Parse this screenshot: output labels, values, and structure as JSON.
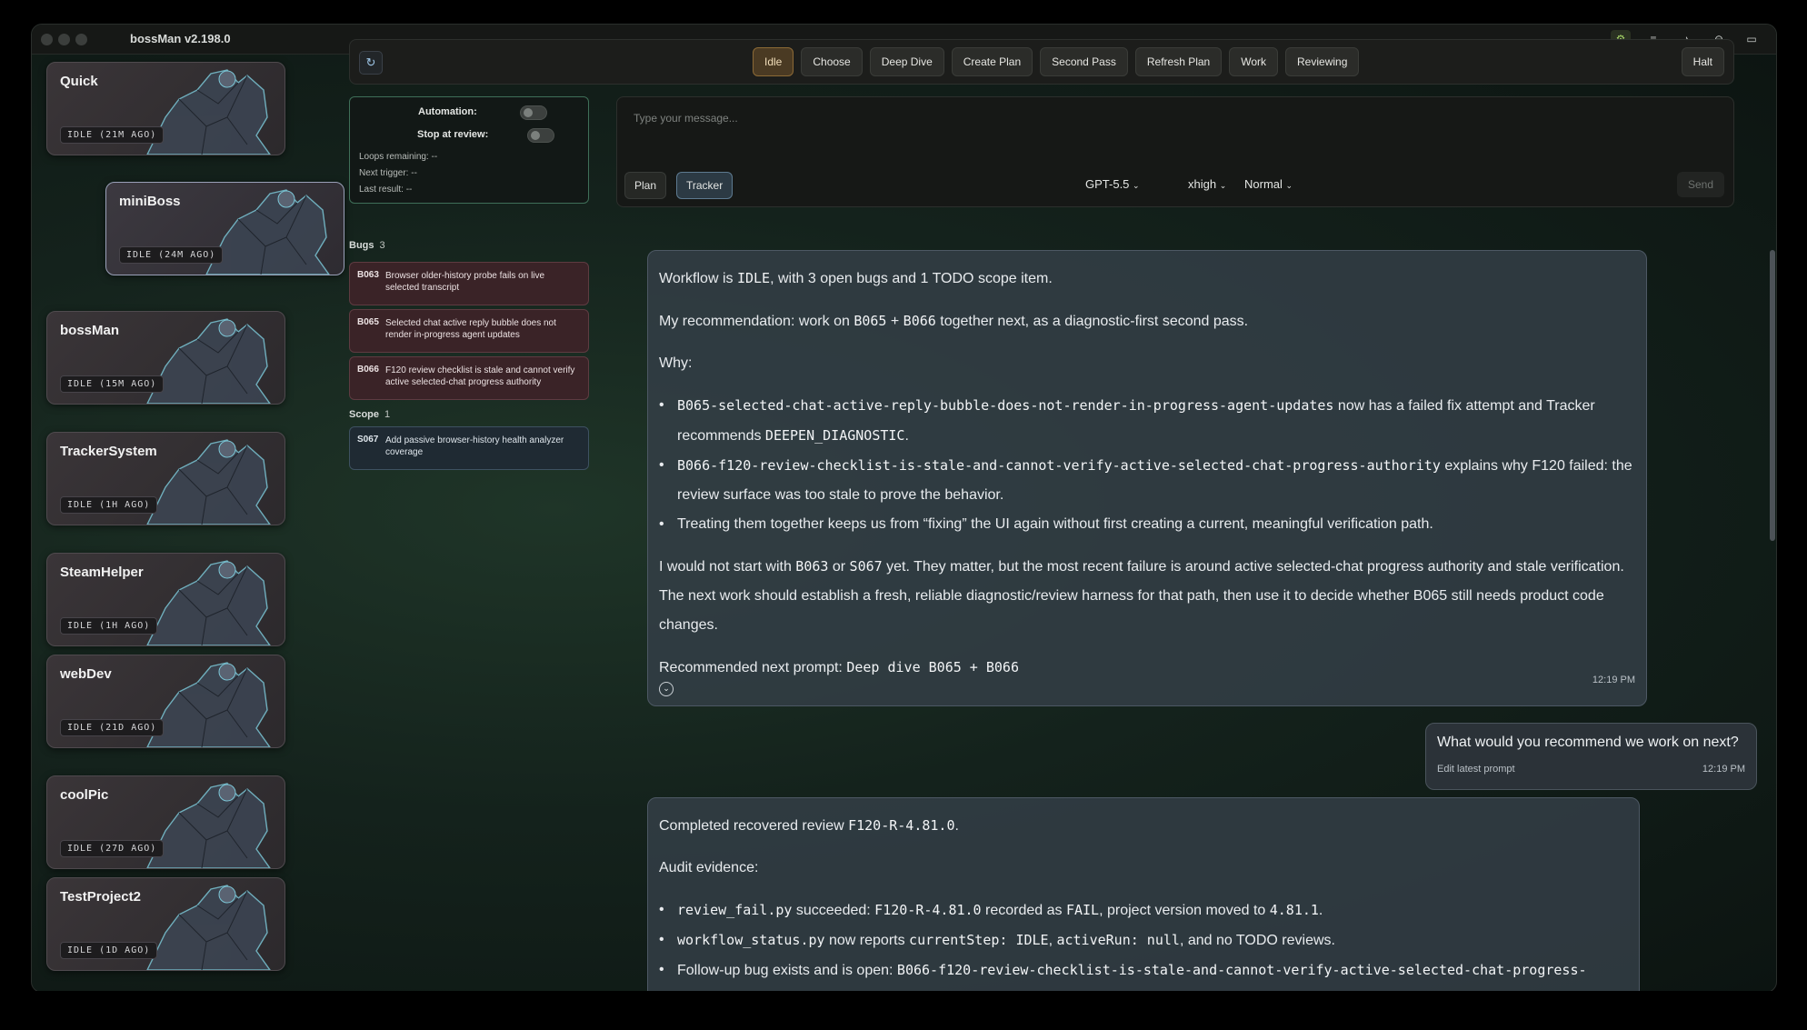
{
  "app": {
    "title": "bossMan v2.198.0"
  },
  "sidebar": {
    "projects": [
      {
        "name": "Quick",
        "status": "IDLE (21M AGO)"
      },
      {
        "name": "miniBoss",
        "status": "IDLE (24M AGO)"
      },
      {
        "name": "bossMan",
        "status": "IDLE (15M AGO)"
      },
      {
        "name": "TrackerSystem",
        "status": "IDLE (1H AGO)"
      },
      {
        "name": "SteamHelper",
        "status": "IDLE (1H AGO)"
      },
      {
        "name": "webDev",
        "status": "IDLE (21D AGO)"
      },
      {
        "name": "coolPic",
        "status": "IDLE (27D AGO)"
      },
      {
        "name": "TestProject2",
        "status": "IDLE (1D AGO)"
      }
    ]
  },
  "toolbar": {
    "refresh_icon": "↻",
    "workflow": [
      "Idle",
      "Choose",
      "Deep Dive",
      "Create Plan",
      "Second Pass",
      "Refresh Plan",
      "Work",
      "Reviewing"
    ],
    "halt": "Halt"
  },
  "automation": {
    "automation_label": "Automation:",
    "stop_label": "Stop at review:",
    "loops": "Loops remaining: --",
    "next_trigger": "Next trigger: --",
    "last_result": "Last result: --"
  },
  "bugs": {
    "title": "Bugs",
    "count": "3",
    "items": [
      {
        "id": "B063",
        "text": "Browser older-history probe fails on live selected transcript"
      },
      {
        "id": "B065",
        "text": "Selected chat active reply bubble does not render in-progress agent updates"
      },
      {
        "id": "B066",
        "text": "F120 review checklist is stale and cannot verify active selected-chat progress authority"
      }
    ]
  },
  "scope": {
    "title": "Scope",
    "count": "1",
    "items": [
      {
        "id": "S067",
        "text": "Add passive browser-history health analyzer coverage"
      }
    ]
  },
  "composer": {
    "placeholder": "Type your message...",
    "plan": "Plan",
    "tracker": "Tracker",
    "model": "GPT-5.5",
    "effort": "xhigh",
    "speed": "Normal",
    "send": "Send"
  },
  "messages": {
    "m1": {
      "p1a": "Workflow is ",
      "p1b": "IDLE",
      "p1c": ", with 3 open bugs and 1 TODO scope item.",
      "p2a": "My recommendation: work on ",
      "p2b": "B065",
      "p2c": " + ",
      "p2d": "B066",
      "p2e": " together next, as a diagnostic-first second pass.",
      "why": "Why:",
      "b1a": "B065-selected-chat-active-reply-bubble-does-not-render-in-progress-agent-updates",
      "b1b": " now has a failed fix attempt and Tracker recommends ",
      "b1c": "DEEPEN_DIAGNOSTIC",
      "b1d": ".",
      "b2a": "B066-f120-review-checklist-is-stale-and-cannot-verify-active-selected-chat-progress-authority",
      "b2b": " explains why F120 failed: the review surface was too stale to prove the behavior.",
      "b3": "Treating them together keeps us from “fixing” the UI again without first creating a current, meaningful verification path.",
      "p3a": "I would not start with ",
      "p3b": "B063",
      "p3c": " or ",
      "p3d": "S067",
      "p3e": " yet. They matter, but the most recent failure is around active selected-chat progress authority and stale verification. The next work should establish a fresh, reliable diagnostic/review harness for that path, then use it to decide whether B065 still needs product code changes.",
      "p4a": "Recommended next prompt: ",
      "p4b": "Deep dive B065 + B066",
      "time": "12:19 PM"
    },
    "user": {
      "text": "What would you recommend we work on next?",
      "edit": "Edit latest prompt",
      "time": "12:19 PM"
    },
    "m2": {
      "p1a": "Completed recovered review ",
      "p1b": "F120-R-4.81.0",
      "p1c": ".",
      "p2": "Audit evidence:",
      "b1a": "review_fail.py",
      "b1b": " succeeded: ",
      "b1c": "F120-R-4.81.0",
      "b1d": " recorded as ",
      "b1e": "FAIL",
      "b1f": ", project version moved to ",
      "b1g": "4.81.1",
      "b1h": ".",
      "b2a": "workflow_status.py",
      "b2b": " now reports ",
      "b2c": "currentStep: IDLE",
      "b2d": ", ",
      "b2e": "activeRun: null",
      "b2f": ", and no TODO reviews.",
      "b3a": "Follow-up bug exists and is open: ",
      "b3b": "B066-f120-review-checklist-is-stale-and-cannot-verify-active-selected-chat-progress-"
    }
  }
}
